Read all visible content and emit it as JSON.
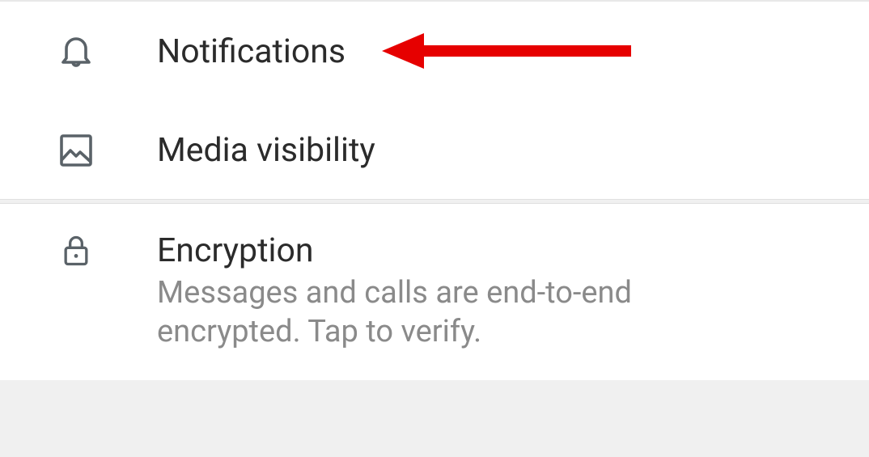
{
  "settings": {
    "items": [
      {
        "icon": "bell-icon",
        "title": "Notifications",
        "subtitle": null
      },
      {
        "icon": "image-icon",
        "title": "Media visibility",
        "subtitle": null
      },
      {
        "icon": "lock-icon",
        "title": "Encryption",
        "subtitle": "Messages and calls are end-to-end encrypted. Tap to verify."
      }
    ]
  },
  "colors": {
    "icon": "#5a6268",
    "arrow": "#e60000"
  }
}
